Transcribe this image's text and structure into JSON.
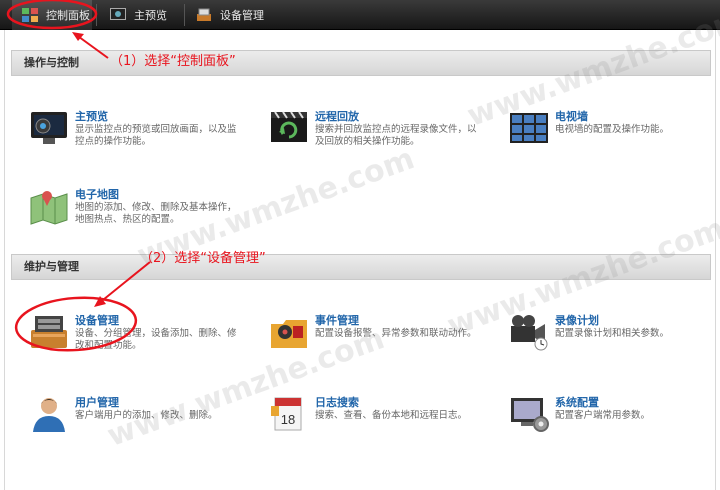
{
  "tabs": [
    {
      "label": "控制面板",
      "icon": "control-panel-icon"
    },
    {
      "label": "主预览",
      "icon": "preview-icon"
    },
    {
      "label": "设备管理",
      "icon": "device-icon"
    }
  ],
  "sections": {
    "ops": "操作与控制",
    "maint": "维护与管理"
  },
  "items": [
    {
      "title": "主预览",
      "desc": "显示监控点的预览或回放画面，以及监控点的操作功能。"
    },
    {
      "title": "远程回放",
      "desc": "搜索并回放监控点的远程录像文件，以及回放的相关操作功能。"
    },
    {
      "title": "电视墙",
      "desc": "电视墙的配置及操作功能。"
    },
    {
      "title": "电子地图",
      "desc": "地图的添加、修改、删除及基本操作，地图热点、热区的配置。"
    },
    {
      "title": "设备管理",
      "desc": "设备、分组管理，设备添加、删除、修改和配置功能。"
    },
    {
      "title": "事件管理",
      "desc": "配置设备报警、异常参数和联动动作。"
    },
    {
      "title": "录像计划",
      "desc": "配置录像计划和相关参数。"
    },
    {
      "title": "用户管理",
      "desc": "客户端用户的添加、修改、删除。"
    },
    {
      "title": "日志搜索",
      "desc": "搜索、查看、备份本地和远程日志。"
    },
    {
      "title": "系统配置",
      "desc": "配置客户端常用参数。"
    }
  ],
  "annotations": [
    "（1）选择“控制面板”",
    "（2）选择“设备管理”"
  ],
  "watermark": "www.wmzhe.com",
  "calendar_day": "18",
  "colors": {
    "annotation": "#e8141e",
    "title": "#2266aa"
  }
}
